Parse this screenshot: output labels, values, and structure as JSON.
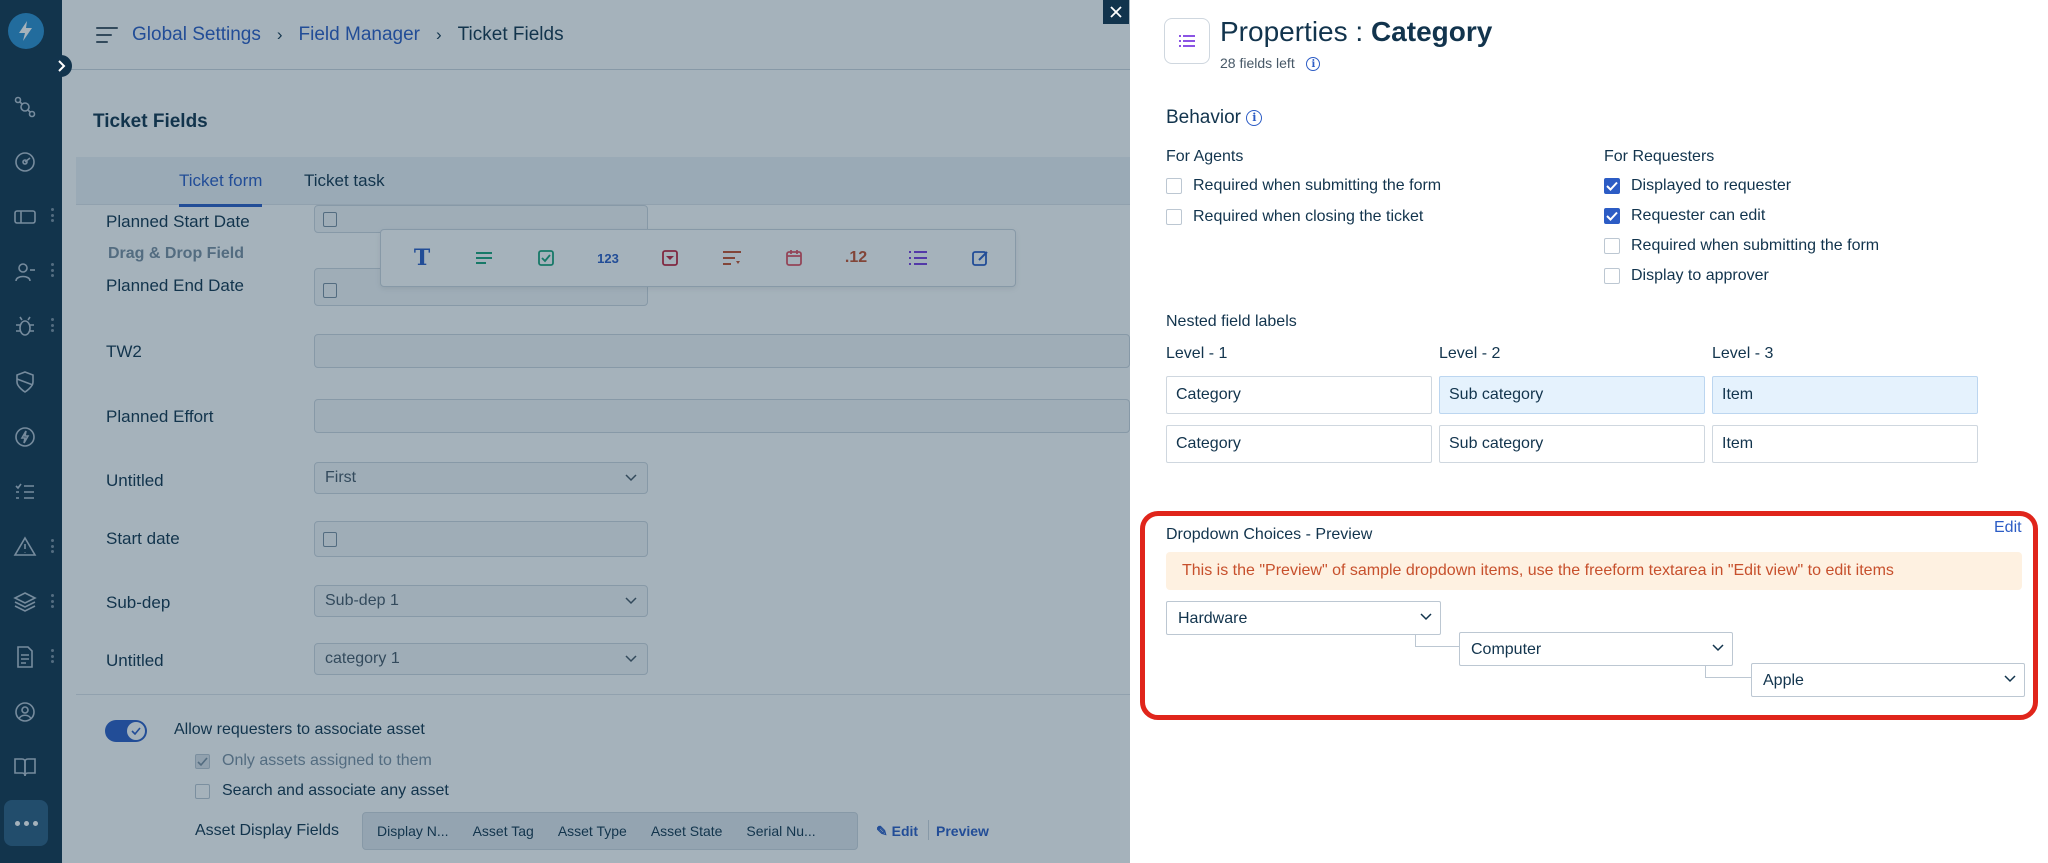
{
  "breadcrumb": {
    "global_settings": "Global Settings",
    "field_manager": "Field Manager",
    "current": "Ticket Fields"
  },
  "page": {
    "title": "Ticket Fields",
    "tabs": [
      "Ticket form",
      "Ticket task"
    ]
  },
  "form_fields": {
    "planned_start_date": "Planned Start Date",
    "drag_drop": "Drag & Drop Field",
    "planned_end_date": "Planned End Date",
    "tw2": "TW2",
    "planned_effort": "Planned Effort",
    "untitled_1": "Untitled",
    "untitled_1_value": "First",
    "start_date": "Start date",
    "sub_dep": "Sub-dep",
    "sub_dep_value": "Sub-dep 1",
    "untitled_2": "Untitled",
    "untitled_2_value": "category 1"
  },
  "toolbar": {
    "number_label": "123",
    "decimal_label": ".12"
  },
  "assets": {
    "allow_label": "Allow requesters to associate asset",
    "only_assigned": "Only assets assigned to them",
    "search_any": "Search and associate any asset",
    "display_fields_label": "Asset Display Fields",
    "display_fields": [
      "Display N...",
      "Asset Tag",
      "Asset Type",
      "Asset State",
      "Serial Nu..."
    ],
    "edit": "Edit",
    "preview": "Preview"
  },
  "panel": {
    "title_prefix": "Properties : ",
    "title_name": "Category",
    "fields_left": "28 fields left",
    "behavior": "Behavior",
    "for_agents": "For Agents",
    "agents": [
      {
        "label": "Required when submitting the form",
        "checked": false
      },
      {
        "label": "Required when closing the ticket",
        "checked": false
      }
    ],
    "for_requesters": "For Requesters",
    "requesters": [
      {
        "label": "Displayed to requester",
        "checked": true
      },
      {
        "label": "Requester can edit",
        "checked": true
      },
      {
        "label": "Required when submitting the form",
        "checked": false
      },
      {
        "label": "Display to approver",
        "checked": false
      }
    ],
    "nested_title": "Nested field labels",
    "levels": [
      "Level - 1",
      "Level - 2",
      "Level - 3"
    ],
    "agent_labels": [
      "Category",
      "Sub category",
      "Item"
    ],
    "requester_labels": [
      "Category",
      "Sub category",
      "Item"
    ],
    "dropdown_title": "Dropdown Choices - Preview",
    "dropdown_edit": "Edit",
    "warning": "This is the \"Preview\" of sample dropdown items, use the freeform textarea in \"Edit view\" to edit items",
    "choice_1": "Hardware",
    "choice_2": "Computer",
    "choice_3": "Apple"
  },
  "colors": {
    "sidebar": "#12344d",
    "link": "#2c5cc5",
    "highlight_box": "#e0251b",
    "warning_bg": "#fef1e1",
    "warning_text": "#c7502c"
  }
}
